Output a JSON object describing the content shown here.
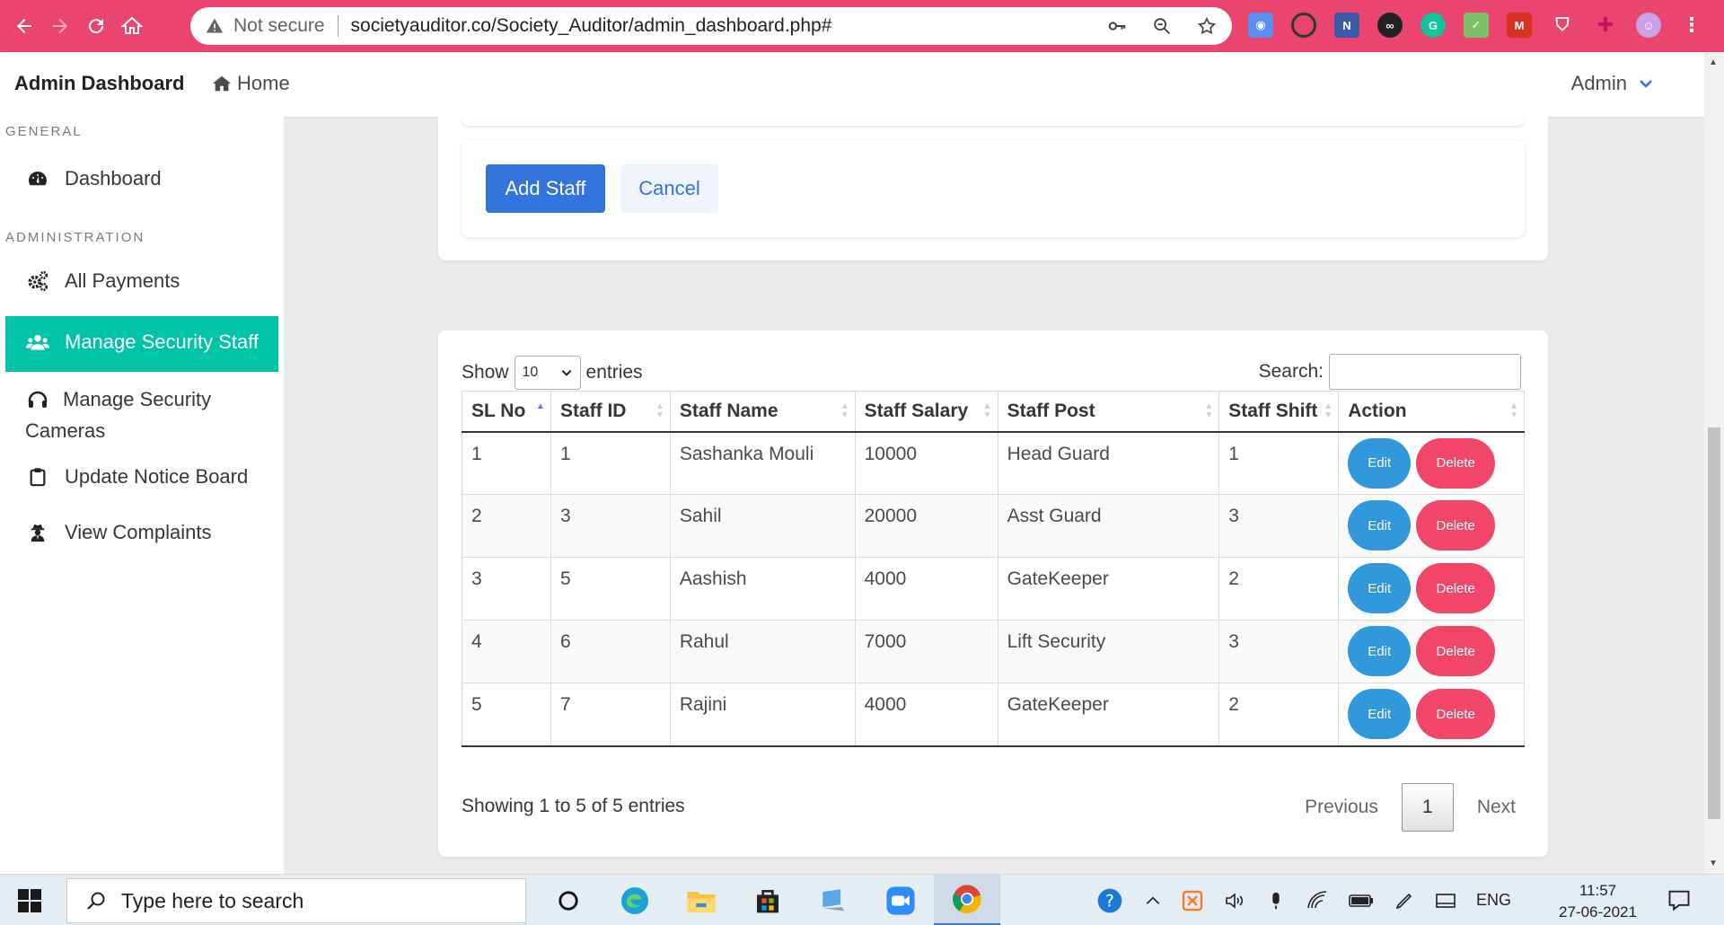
{
  "browser": {
    "security_label": "Not secure",
    "url": "societyauditor.co/Society_Auditor/admin_dashboard.php#"
  },
  "topnav": {
    "brand": "Admin Dashboard",
    "home": "Home",
    "user": "Admin"
  },
  "sidebar": {
    "general_label": "GENERAL",
    "admin_label": "ADMINISTRATION",
    "items": [
      {
        "label": "Dashboard",
        "icon": "tachometer-icon"
      },
      {
        "label": "All Payments",
        "icon": "cogs-icon"
      },
      {
        "label": "Manage Security Staff",
        "icon": "users-icon",
        "active": true
      },
      {
        "label": "Manage Security Cameras",
        "icon": "headset-icon"
      },
      {
        "label": "Update Notice Board",
        "icon": "clipboard-icon"
      },
      {
        "label": "View Complaints",
        "icon": "user-secret-icon"
      }
    ]
  },
  "form": {
    "add_label": "Add Staff",
    "cancel_label": "Cancel"
  },
  "table": {
    "show_label": "Show",
    "entries_label": "entries",
    "page_length": "10",
    "search_label": "Search:",
    "search_value": "",
    "columns": [
      "SL No",
      "Staff ID",
      "Staff Name",
      "Staff Salary",
      "Staff Post",
      "Staff Shift",
      "Action"
    ],
    "rows": [
      [
        "1",
        "1",
        "Sashanka Mouli",
        "10000",
        "Head Guard",
        "1"
      ],
      [
        "2",
        "3",
        "Sahil",
        "20000",
        "Asst Guard",
        "3"
      ],
      [
        "3",
        "5",
        "Aashish",
        "4000",
        "GateKeeper",
        "2"
      ],
      [
        "4",
        "6",
        "Rahul",
        "7000",
        "Lift Security",
        "3"
      ],
      [
        "5",
        "7",
        "Rajini",
        "4000",
        "GateKeeper",
        "2"
      ]
    ],
    "edit_label": "Edit",
    "delete_label": "Delete",
    "info": "Showing 1 to 5 of 5 entries",
    "previous": "Previous",
    "page": "1",
    "next": "Next"
  },
  "taskbar": {
    "search_placeholder": "Type here to search",
    "language": "ENG",
    "time": "11:57",
    "date": "27-06-2021"
  },
  "colors": {
    "chrome": "#e9456f",
    "primary": "#3273dc",
    "info": "#3298dc",
    "danger": "#f14668",
    "active_menu": "#00c4a7"
  }
}
